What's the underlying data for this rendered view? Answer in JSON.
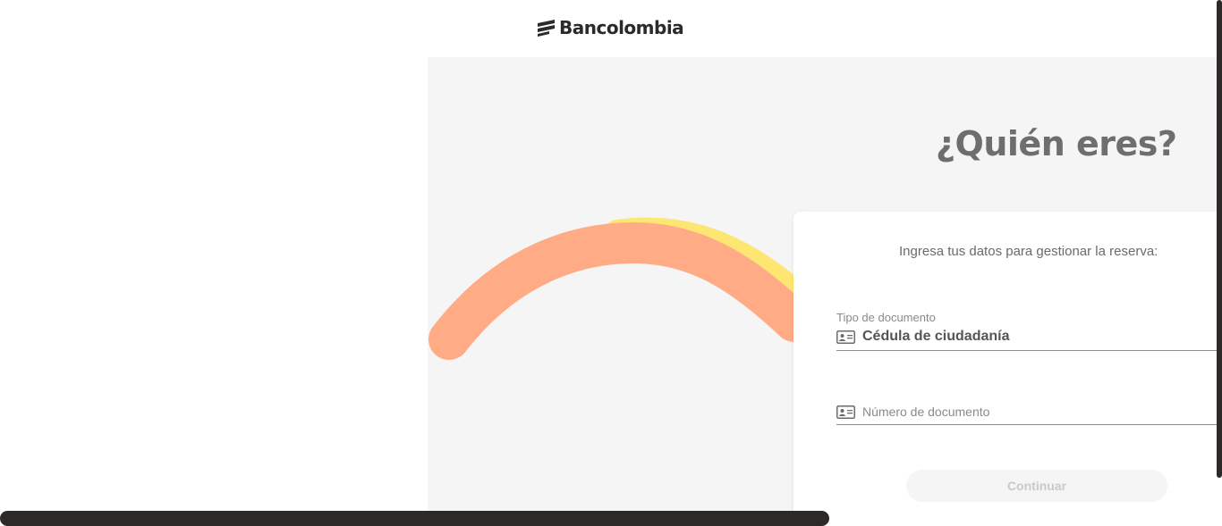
{
  "header": {
    "brand": "Bancolombia",
    "logo_icon": "bancolombia-stripes-icon"
  },
  "main": {
    "title": "¿Quién eres?",
    "subtitle": "Ingresa tus datos para gestionar la reserva:"
  },
  "form": {
    "doc_type_label": "Tipo de documento",
    "doc_type_value": "Cédula de ciudadanía",
    "doc_type_icon": "id-card-icon",
    "doc_number_placeholder": "Número de documento",
    "doc_number_value": "",
    "doc_number_icon": "id-card-icon",
    "continue_label": "Continuar"
  },
  "colors": {
    "arc_orange": "#ffab85",
    "arc_yellow": "#fde672",
    "background_panel": "#f5f5f5",
    "title": "#6e6e6e",
    "brand_dark": "#2c2a29"
  }
}
